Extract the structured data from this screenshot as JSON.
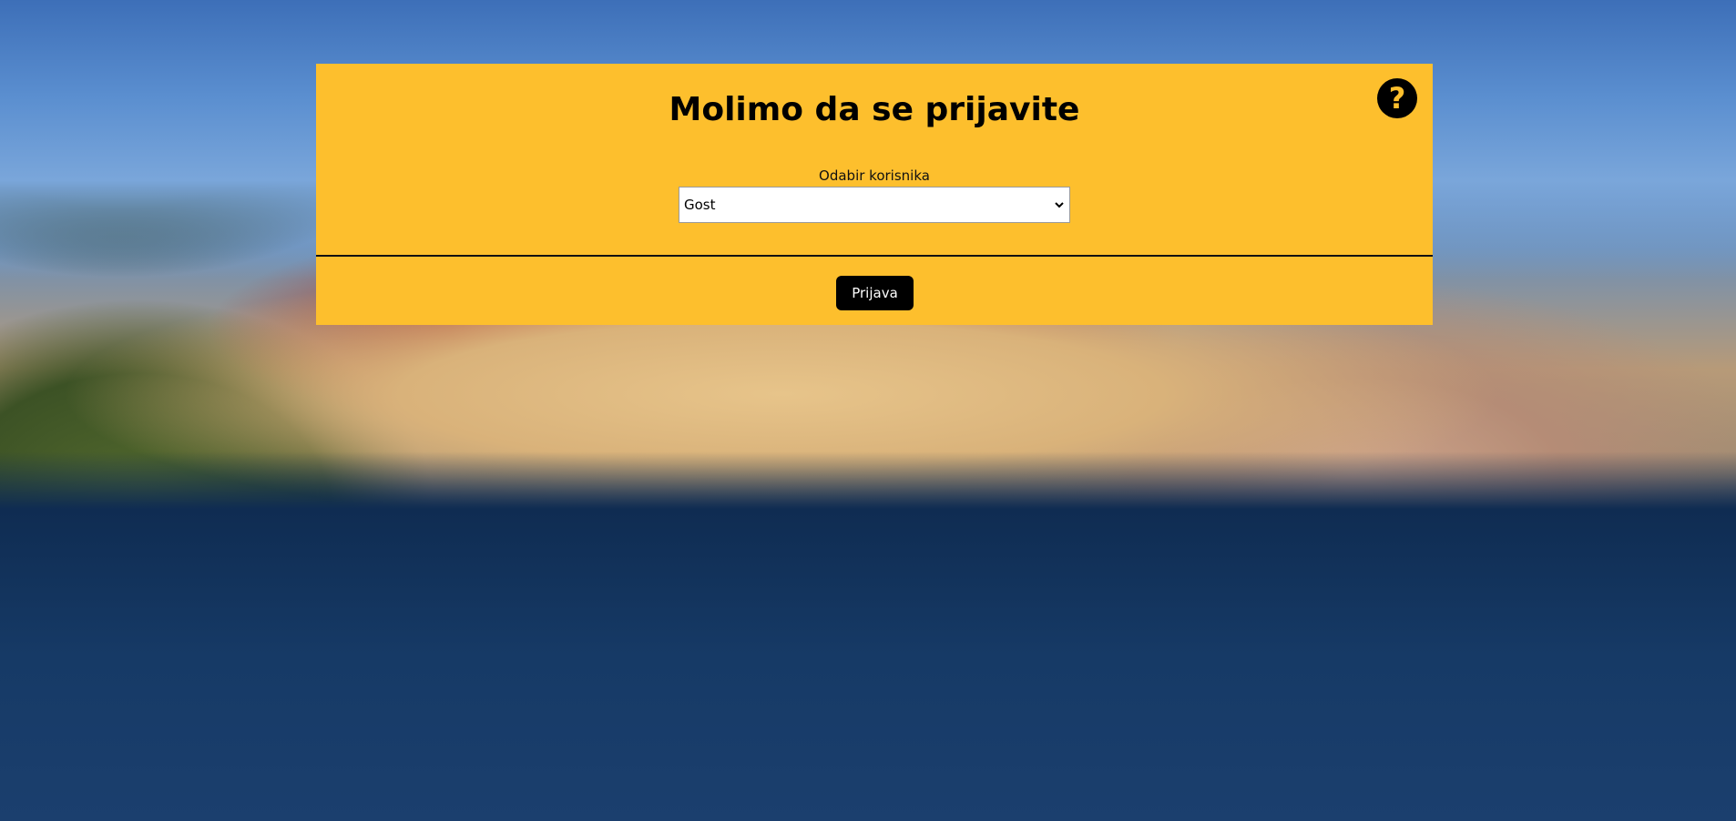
{
  "background": {
    "image_description_icon": "city-landscape-photo"
  },
  "login_panel": {
    "title": "Molimo da se prijavite",
    "help_icon": "question-circle-icon",
    "user_select": {
      "label": "Odabir korisnika",
      "selected_value": "Gost"
    },
    "login_button_label": "Prijava",
    "accent_color": "#fdbf2d"
  }
}
